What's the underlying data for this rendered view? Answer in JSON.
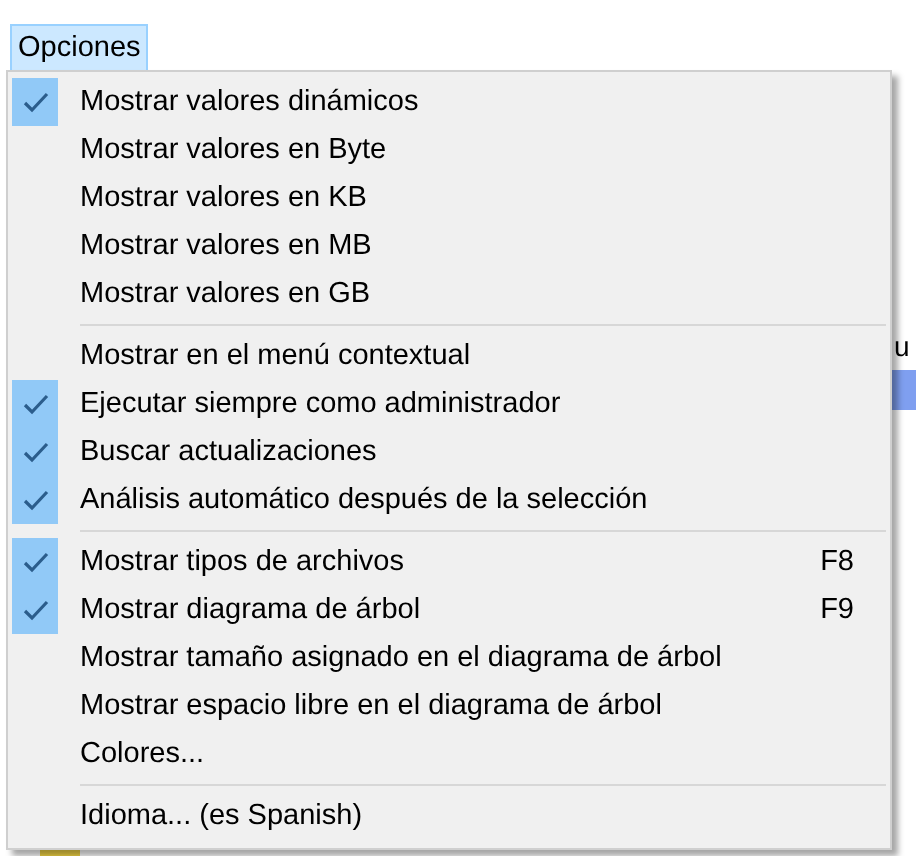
{
  "menu_bar": [
    {
      "label": "Opciones",
      "selected": true
    }
  ],
  "background": {
    "column_header_fragment": "u"
  },
  "menu": {
    "sections": [
      [
        {
          "label": "Mostrar valores dinámicos",
          "checked": true
        },
        {
          "label": "Mostrar valores en Byte",
          "checked": false
        },
        {
          "label": "Mostrar valores en KB",
          "checked": false
        },
        {
          "label": "Mostrar valores en MB",
          "checked": false
        },
        {
          "label": "Mostrar valores en GB",
          "checked": false
        }
      ],
      [
        {
          "label": "Mostrar en el menú contextual",
          "checked": false
        },
        {
          "label": "Ejecutar siempre como administrador",
          "checked": true
        },
        {
          "label": "Buscar actualizaciones",
          "checked": true
        },
        {
          "label": "Análisis automático después de la selección",
          "checked": true
        }
      ],
      [
        {
          "label": "Mostrar tipos de archivos",
          "checked": true,
          "shortcut": "F8"
        },
        {
          "label": "Mostrar diagrama de árbol",
          "checked": true,
          "shortcut": "F9"
        },
        {
          "label": "Mostrar tamaño asignado en el diagrama de árbol",
          "checked": false
        },
        {
          "label": "Mostrar espacio libre en el diagrama de árbol",
          "checked": false
        },
        {
          "label": "Colores...",
          "checked": false
        }
      ],
      [
        {
          "label": "Idioma... (es Spanish)",
          "checked": false
        }
      ]
    ]
  }
}
